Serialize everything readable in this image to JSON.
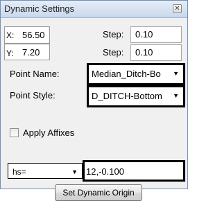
{
  "window": {
    "title": "Dynamic Settings",
    "close_glyph": "✕"
  },
  "coords": {
    "x_label": "X:",
    "x_value": "56.50",
    "y_label": "Y:",
    "y_value": "7.20",
    "step_label": "Step:",
    "x_step": "0.10",
    "y_step": "0.10"
  },
  "point_name": {
    "label": "Point Name:",
    "value": "Median_Ditch-Bo"
  },
  "point_style": {
    "label": "Point Style:",
    "value": "D_DITCH-Bottom"
  },
  "affixes": {
    "label": "Apply Affixes",
    "checked": false
  },
  "mode": {
    "selected": "hs="
  },
  "value_input": "12,-0.100",
  "set_origin_label": "Set Dynamic Origin",
  "icons": {
    "dropdown": "▼"
  }
}
